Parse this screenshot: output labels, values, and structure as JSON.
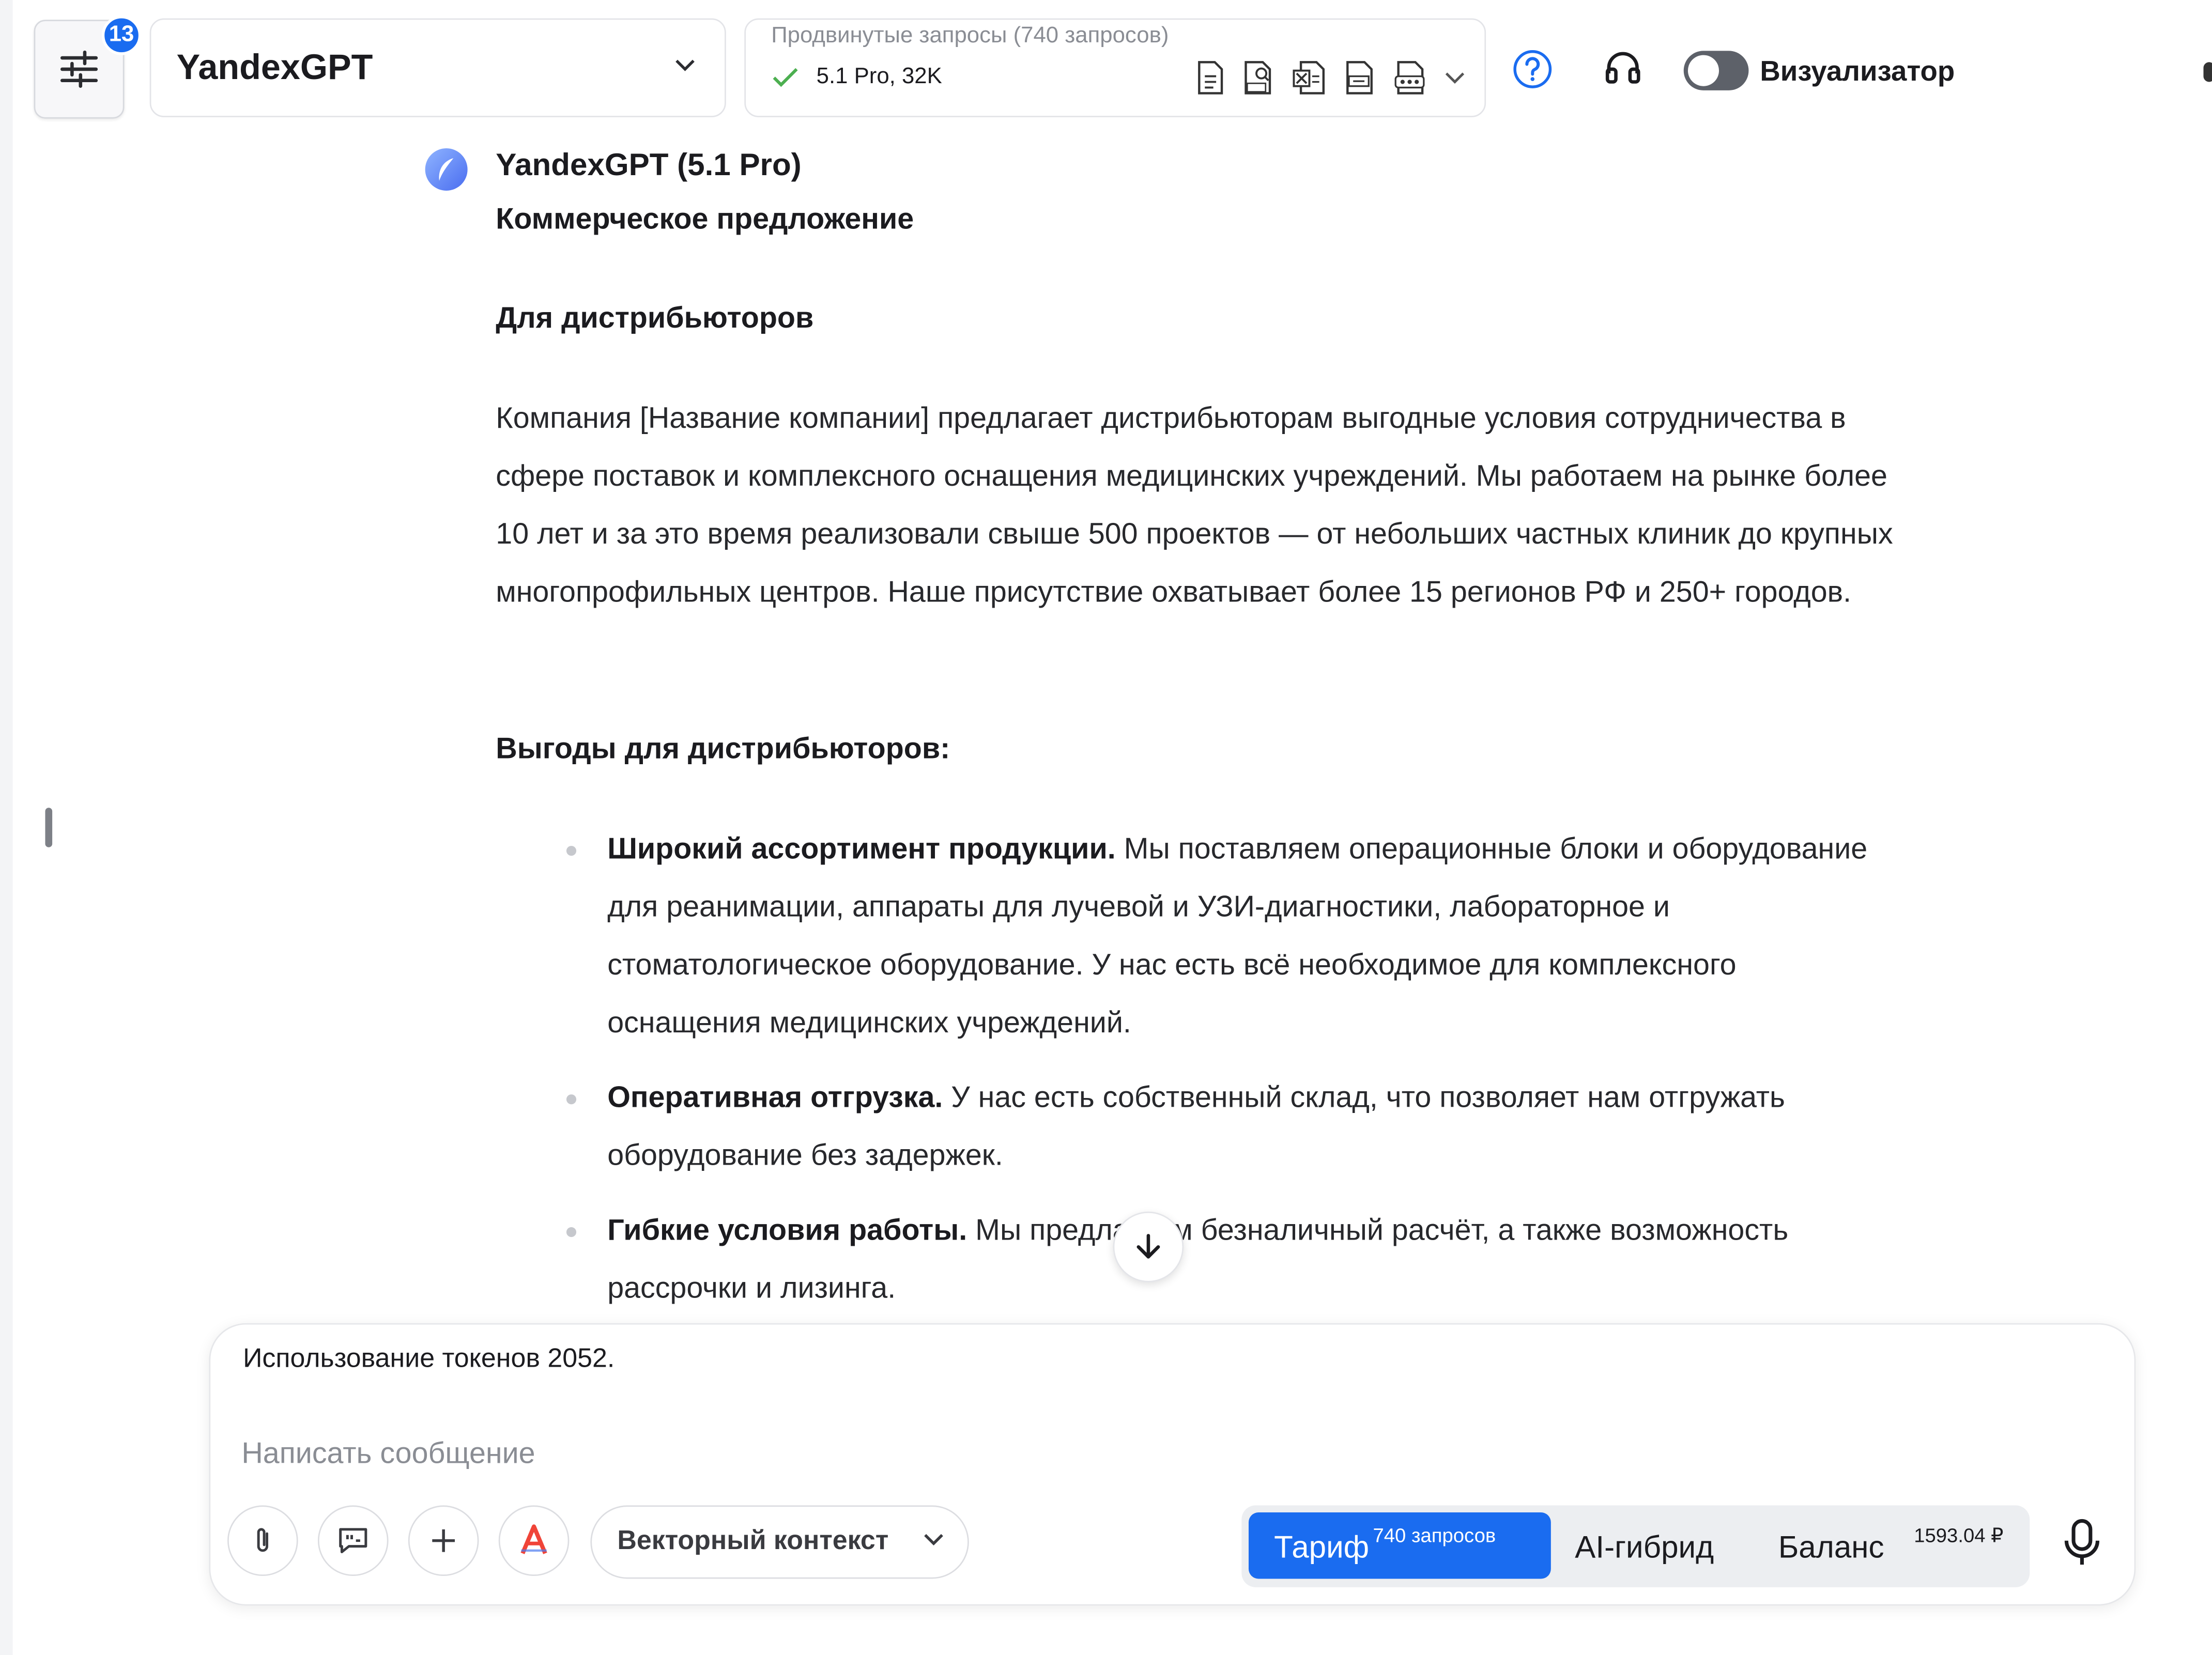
{
  "header": {
    "notification_count": "13",
    "model_select": "YandexGPT",
    "requests_title": "Продвинутые запросы (740 запросов)",
    "requests_status": "5.1 Pro, 32K",
    "export_icons": [
      "doc-icon",
      "pdf-icon",
      "xls-icon",
      "txt-icon",
      "docx-icon"
    ],
    "visualizer_label": "Визуализатор",
    "visualizer_enabled": false
  },
  "message": {
    "author": "YandexGPT (5.1 Pro)",
    "heading": "Коммерческое предложение",
    "subheading": "Для дистрибьюторов",
    "paragraph": "Компания [Название компании] предлагает дистрибьюторам выгодные условия сотрудничества в сфере поставок и комплексного оснащения медицинских учреждений. Мы работаем на рынке более 10 лет и за это время реализовали свыше 500 проектов — от небольших частных клиник до крупных многопрофильных центров. Наше присутствие охватывает более 15 регионов РФ и 250+ городов.",
    "benefits_heading": "Выгоды для дистрибьюторов:",
    "benefits": [
      {
        "title": "Широкий ассортимент продукции.",
        "text": " Мы поставляем операционные блоки и оборудование для реанимации, аппараты для лучевой и УЗИ-диагностики, лабораторное и стоматологическое оборудование. У нас есть всё необходимое для комплексного оснащения медицинских учреждений."
      },
      {
        "title": "Оперативная отгрузка.",
        "text": " У нас есть собственный склад, что позволяет нам отгружать оборудование без задержек."
      },
      {
        "title": "Гибкие условия работы.",
        "text": " Мы предлагаем безналичный расчёт, а также возможность рассрочки и лизинга."
      }
    ]
  },
  "composer": {
    "token_usage": "Использование токенов 2052.",
    "placeholder": "Написать сообщение",
    "vector_context": "Векторный контекст",
    "tariff_label": "Тариф",
    "tariff_sup": "740 запросов",
    "hybrid_label": "AI-гибрид",
    "balance_label": "Баланс",
    "balance_sup": "1593.04 ₽"
  },
  "colors": {
    "accent": "#1a6cf0",
    "toggle_off": "#5d6169"
  }
}
